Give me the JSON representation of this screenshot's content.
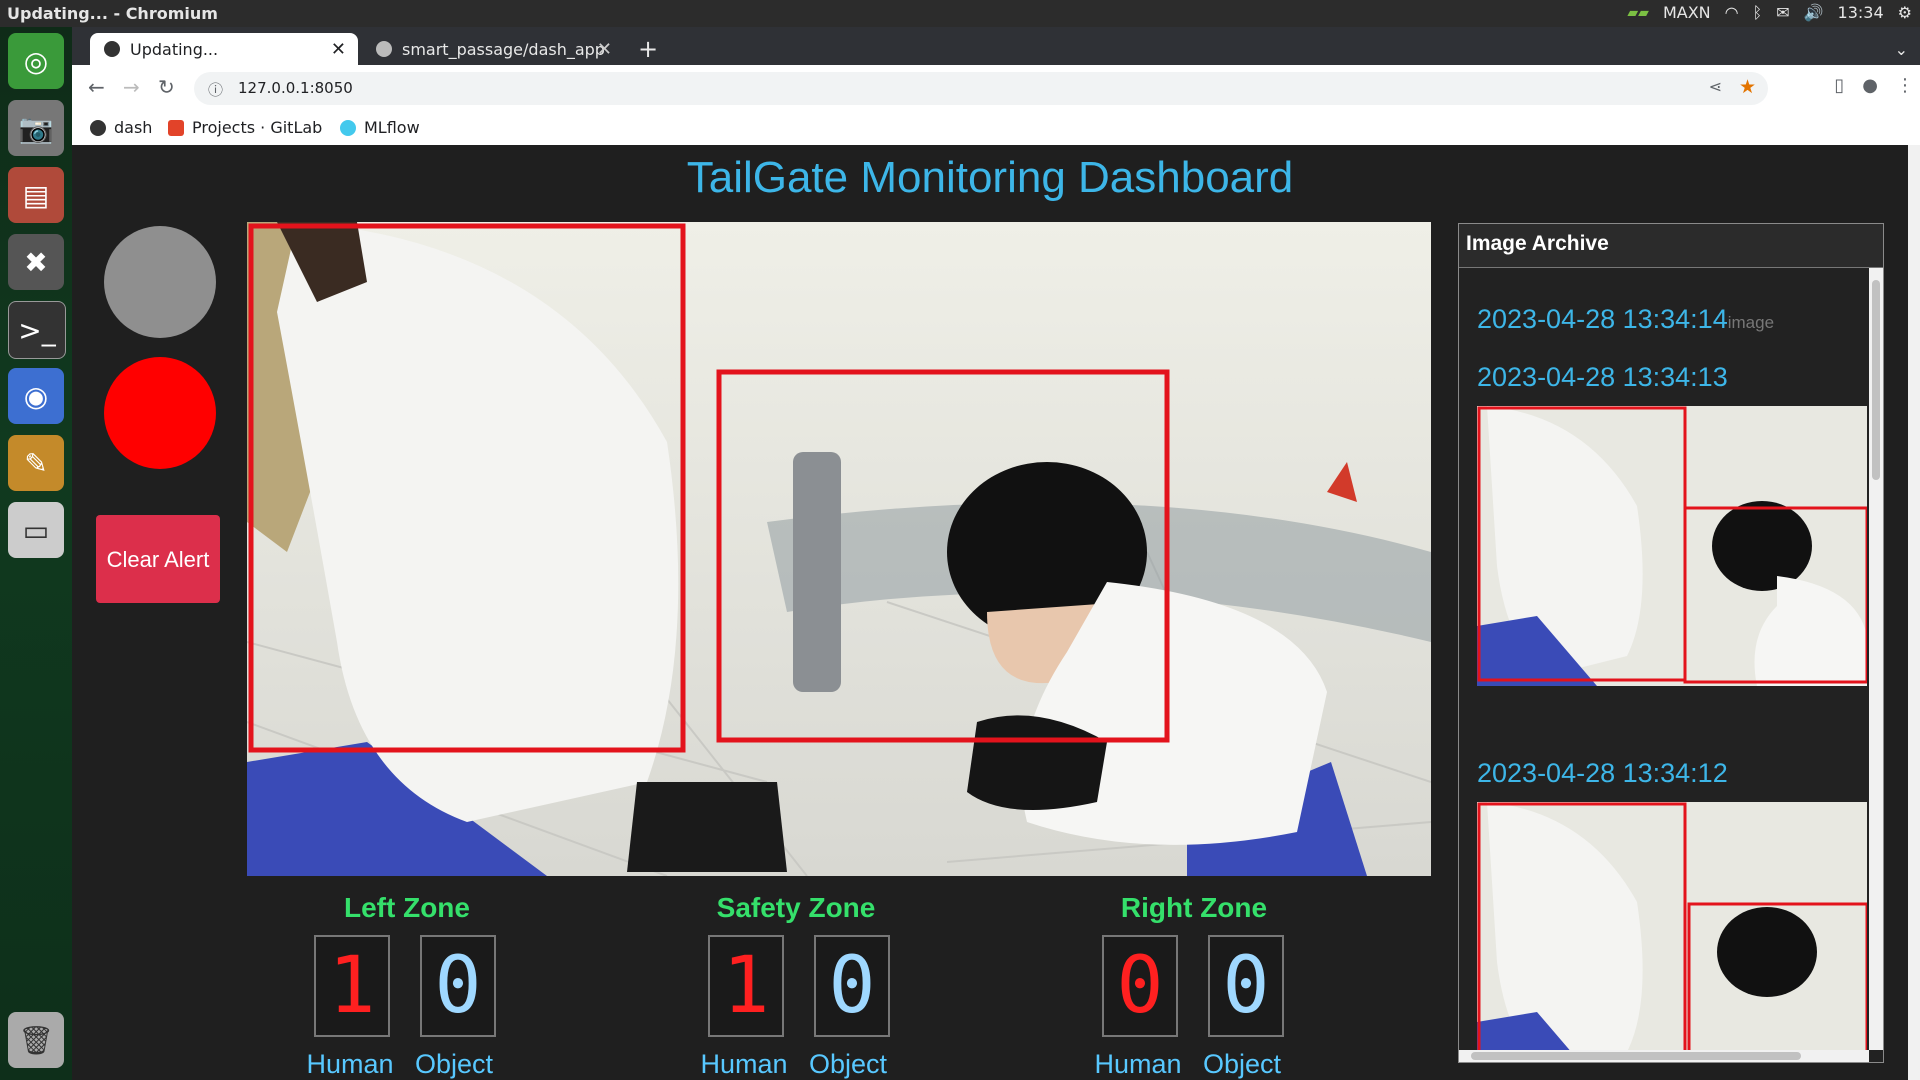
{
  "os": {
    "window_title": "Updating... - Chromium",
    "tray": {
      "gpu_mode": "MAXN",
      "time": "13:34"
    }
  },
  "browser": {
    "tabs": [
      {
        "label": "Updating...",
        "active": true
      },
      {
        "label": "smart_passage/dash_app",
        "active": false
      }
    ],
    "new_tab": "+",
    "url": "127.0.0.1:8050",
    "bookmarks": [
      {
        "label": "dash"
      },
      {
        "label": "Projects · GitLab"
      },
      {
        "label": "MLflow"
      }
    ]
  },
  "dashboard": {
    "title": "TailGate Monitoring Dashboard",
    "indicators": [
      {
        "color": "#8f8f8f"
      },
      {
        "color": "#ff0000"
      }
    ],
    "clear_alert_button": "Clear Alert",
    "zones": [
      {
        "name": "Left Zone",
        "human": "1",
        "object": "0",
        "human_color": "#ff2020",
        "object_color": "#9fd8ff"
      },
      {
        "name": "Safety Zone",
        "human": "1",
        "object": "0",
        "human_color": "#ff2020",
        "object_color": "#9fd8ff"
      },
      {
        "name": "Right Zone",
        "human": "0",
        "object": "0",
        "human_color": "#ff2020",
        "object_color": "#9fd8ff"
      }
    ],
    "count_labels": {
      "human": "Human",
      "object": "Object"
    }
  },
  "archive": {
    "header": "Image Archive",
    "entries": [
      {
        "timestamp": "2023-04-28 13:34:14",
        "broken_image_alt": "image"
      },
      {
        "timestamp": "2023-04-28 13:34:13"
      },
      {
        "timestamp": "2023-04-28 13:34:12"
      }
    ]
  }
}
